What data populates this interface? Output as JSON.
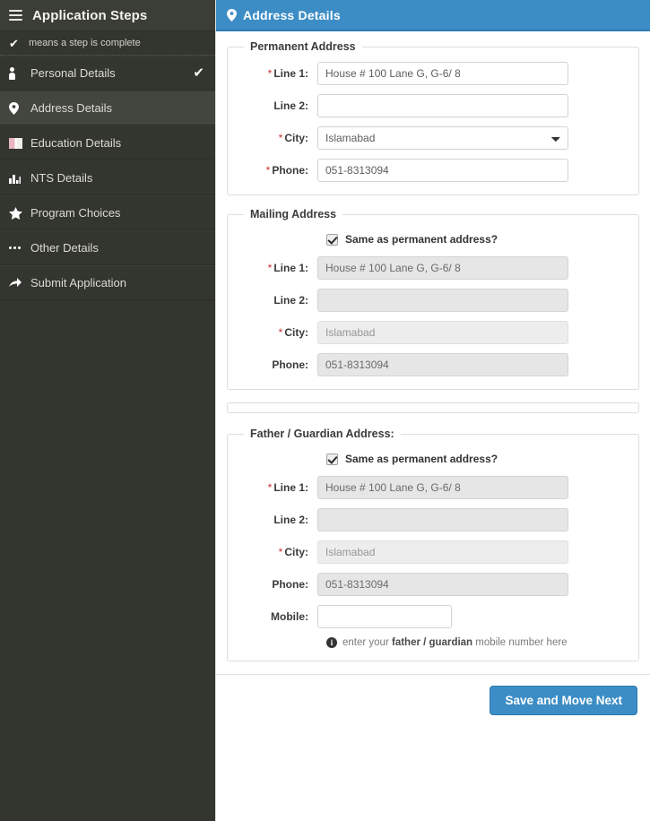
{
  "sidebar": {
    "title": "Application Steps",
    "menu_icon": "hamburger-icon",
    "legend": {
      "icon": "check-icon",
      "text": "means a step is complete"
    },
    "items": [
      {
        "label": "Personal Details",
        "icon": "person-icon",
        "complete": "✔",
        "active": false
      },
      {
        "label": "Address Details",
        "icon": "map-pin-icon",
        "complete": "",
        "active": true
      },
      {
        "label": "Education Details",
        "icon": "book-icon",
        "complete": "",
        "active": false
      },
      {
        "label": "NTS Details",
        "icon": "bar-chart-icon",
        "complete": "",
        "active": false
      },
      {
        "label": "Program Choices",
        "icon": "star-icon",
        "complete": "",
        "active": false
      },
      {
        "label": "Other Details",
        "icon": "ellipsis-icon",
        "complete": "",
        "active": false
      },
      {
        "label": "Submit Application",
        "icon": "arrow-icon",
        "complete": "",
        "active": false
      }
    ]
  },
  "panel": {
    "icon": "map-pin-icon",
    "title": "Address Details"
  },
  "permanent": {
    "legend": "Permanent Address",
    "line1_label": "Line 1:",
    "line1_value": "House # 100 Lane G, G-6/ 8",
    "line2_label": "Line 2:",
    "line2_value": "",
    "city_label": "City:",
    "city_value": "Islamabad",
    "phone_label": "Phone:",
    "phone_value": "051-8313094"
  },
  "mailing": {
    "legend": "Mailing Address",
    "same_label": "Same as permanent address?",
    "same_checked": true,
    "line1_label": "Line 1:",
    "line1_value": "House # 100 Lane G, G-6/ 8",
    "line2_label": "Line 2:",
    "line2_value": "",
    "city_label": "City:",
    "city_value": "Islamabad",
    "phone_label": "Phone:",
    "phone_value": "051-8313094"
  },
  "father": {
    "legend": "Father / Guardian Address:",
    "same_label": "Same as permanent address?",
    "same_checked": true,
    "line1_label": "Line 1:",
    "line1_value": "House # 100 Lane G, G-6/ 8",
    "line2_label": "Line 2:",
    "line2_value": "",
    "city_label": "City:",
    "city_value": "Islamabad",
    "phone_label": "Phone:",
    "phone_value": "051-8313094",
    "mobile_label": "Mobile:",
    "mobile_value": "",
    "hint_icon": "info-icon",
    "hint_prefix": "enter your ",
    "hint_bold": "father / guardian",
    "hint_suffix": " mobile number here"
  },
  "footer": {
    "save_label": "Save and Move Next"
  },
  "colors": {
    "sidebar_bg": "#33352f",
    "sidebar_active": "#43453f",
    "accent_blue": "#3c8dc5",
    "required_red": "#c9302c",
    "disabled_bg": "#e6e6e6"
  }
}
